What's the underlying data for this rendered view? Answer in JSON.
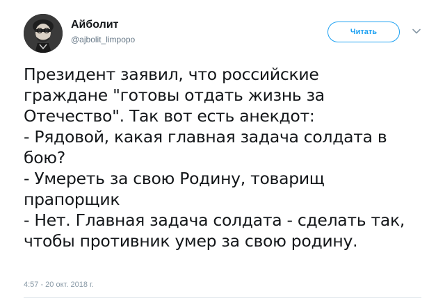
{
  "author": {
    "name": "Айболит",
    "handle": "@ajbolit_limpopo"
  },
  "follow_button": {
    "label": "Читать"
  },
  "tweet": {
    "lines": [
      "Президент заявил, что российские",
      "граждане \"готовы отдать жизнь за",
      "Отечество\". Так вот есть анекдот:",
      "- Рядовой, какая главная задача солдата в",
      "бою?",
      "- Умереть за свою Родину, товарищ",
      "прапорщик",
      "- Нет. Главная задача солдата - сделать так,",
      "чтобы противник умер за свою родину."
    ],
    "timestamp": "4:57 - 20 окт. 2018 г."
  },
  "icons": {
    "avatar": "avatar-portrait",
    "menu": "chevron-down-icon"
  },
  "colors": {
    "accent": "#1da1f2",
    "text": "#14171a",
    "secondary_text": "#657786",
    "timestamp": "#8899a6",
    "divider": "#e6ecf0"
  }
}
